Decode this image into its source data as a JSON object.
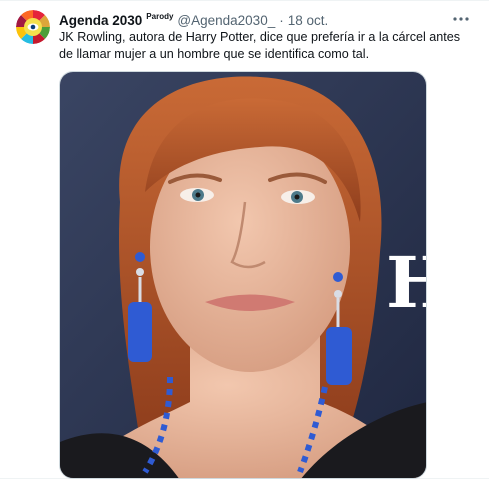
{
  "tweet": {
    "display_name": "Agenda 2030",
    "parody_label": "Parody",
    "handle": "@Agenda2030_",
    "separator": "·",
    "time": "18 oct.",
    "more_icon": "more-horizontal-icon",
    "text": "JK Rowling, autora de Harry Potter, dice que prefería ir a la cárcel antes de llamar mujer a un hombre que se identifica como tal."
  },
  "avatar": {
    "icon": "agenda-2030-sdg-wheel-logo"
  },
  "media": {
    "backdrop_letter": "H",
    "colors": {
      "backdrop": "#2b3550",
      "hair": "#b5562c",
      "skin": "#e7b49a",
      "dress": "#1a1a1e",
      "beads": "#2f5bd3"
    }
  }
}
